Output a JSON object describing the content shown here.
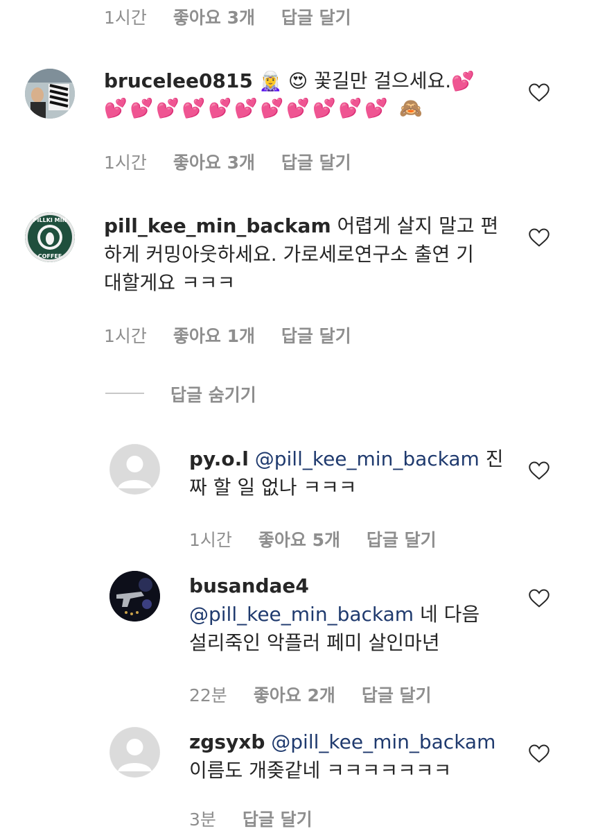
{
  "top_meta": {
    "time": "1시간",
    "likes": "좋아요 3개",
    "reply": "답글 달기"
  },
  "comments": [
    {
      "username": "brucelee0815",
      "emoji_line1": "🧝‍♀️ 😍",
      "text": "꽃길만 걸으세요.",
      "hearts": "💕💕💕💕💕💕💕💕💕💕💕",
      "end_emoji": "🙈",
      "time": "1시간",
      "likes": "좋아요 3개",
      "reply": "답글 달기"
    },
    {
      "username": "pill_kee_min_backam",
      "text_line1": "어렵게 살지 말고 편",
      "text_line2": "하게 커밍아웃하세요. 가로세로연구소 출연 기",
      "text_line3": "대할게요 ㅋㅋㅋ",
      "avatar_text": "PILLKI MIN COFFEE",
      "time": "1시간",
      "likes": "좋아요 1개",
      "reply": "답글 달기"
    }
  ],
  "hide_replies": "답글 숨기기",
  "replies": [
    {
      "username": "py.o.l",
      "mention": "@pill_kee_min_backam",
      "text_after_mention": "진",
      "text_line2": "짜 할 일 없나 ㅋㅋㅋ",
      "time": "1시간",
      "likes": "좋아요 5개",
      "reply": "답글 달기"
    },
    {
      "username": "busandae4",
      "mention": "@pill_kee_min_backam",
      "text_after_mention": "네 다음",
      "text_line3": "설리죽인 악플러 페미 살인마년",
      "time": "22분",
      "likes": "좋아요 2개",
      "reply": "답글 달기"
    },
    {
      "username": "zgsyxb",
      "mention": "@pill_kee_min_backam",
      "text_line2": "이름도 개좆같네 ㅋㅋㅋㅋㅋㅋㅋ",
      "time": "3분",
      "reply": "답글 달기"
    }
  ]
}
